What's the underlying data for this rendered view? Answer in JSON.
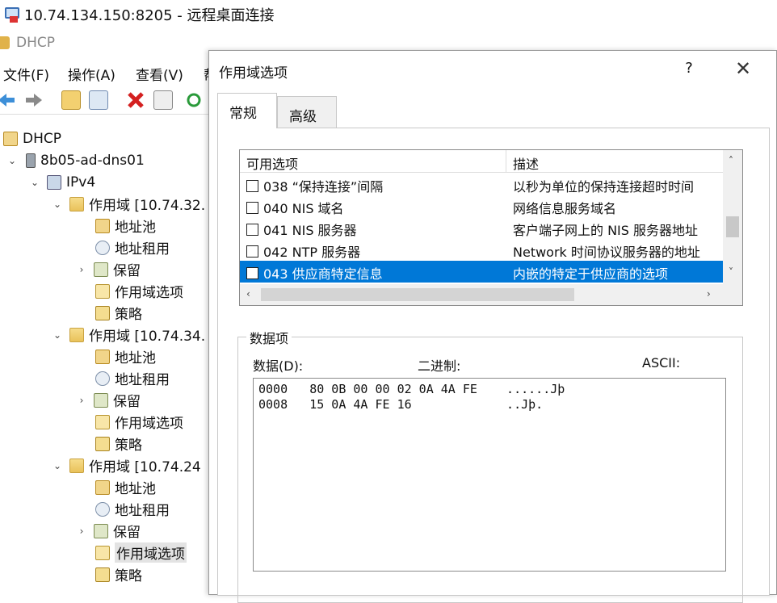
{
  "rdp": {
    "title": "10.74.134.150:8205 - 远程桌面连接"
  },
  "app": {
    "title": "DHCP",
    "menu": [
      "文件(F)",
      "操作(A)",
      "查看(V)",
      "帮"
    ],
    "toolbar_icons": [
      "back-icon",
      "forward-icon",
      "up-folder-icon",
      "show-tree-icon",
      "delete-icon",
      "properties-icon",
      "refresh-icon"
    ]
  },
  "tree": {
    "root": "DHCP",
    "server": "8b05-ad-dns01",
    "ipv4": "IPv4",
    "scopes": [
      {
        "label": "作用域 [10.74.32.",
        "children": [
          "地址池",
          "地址租用",
          "保留",
          "作用域选项",
          "策略"
        ]
      },
      {
        "label": "作用域 [10.74.34.",
        "children": [
          "地址池",
          "地址租用",
          "保留",
          "作用域选项",
          "策略"
        ]
      },
      {
        "label": "作用域 [10.74.24",
        "children": [
          "地址池",
          "地址租用",
          "保留",
          "作用域选项",
          "策略"
        ]
      }
    ],
    "selected": "作用域选项"
  },
  "dialog": {
    "title": "作用域选项",
    "help": "?",
    "close": "✕",
    "tabs": [
      "常规",
      "高级"
    ],
    "list": {
      "headers": [
        "可用选项",
        "描述"
      ],
      "rows": [
        {
          "name": "038 “保持连接”间隔",
          "desc": "以秒为单位的保持连接超时时间",
          "checked": false
        },
        {
          "name": "040 NIS 域名",
          "desc": "网络信息服务域名",
          "checked": false
        },
        {
          "name": "041 NIS 服务器",
          "desc": "客户端子网上的 NIS 服务器地址",
          "checked": false
        },
        {
          "name": "042 NTP 服务器",
          "desc": "Network 时间协议服务器的地址",
          "checked": false
        },
        {
          "name": "043 供应商特定信息",
          "desc": "内嵌的特定于供应商的选项",
          "checked": true
        }
      ]
    },
    "data": {
      "group_label": "数据项",
      "label_data": "数据(D):",
      "label_binary": "二进制:",
      "label_ascii": "ASCII:",
      "hex": "0000   80 0B 00 00 02 0A 4A FE    ......Jþ\n0008   15 0A 4A FE 16             ..Jþ."
    }
  }
}
